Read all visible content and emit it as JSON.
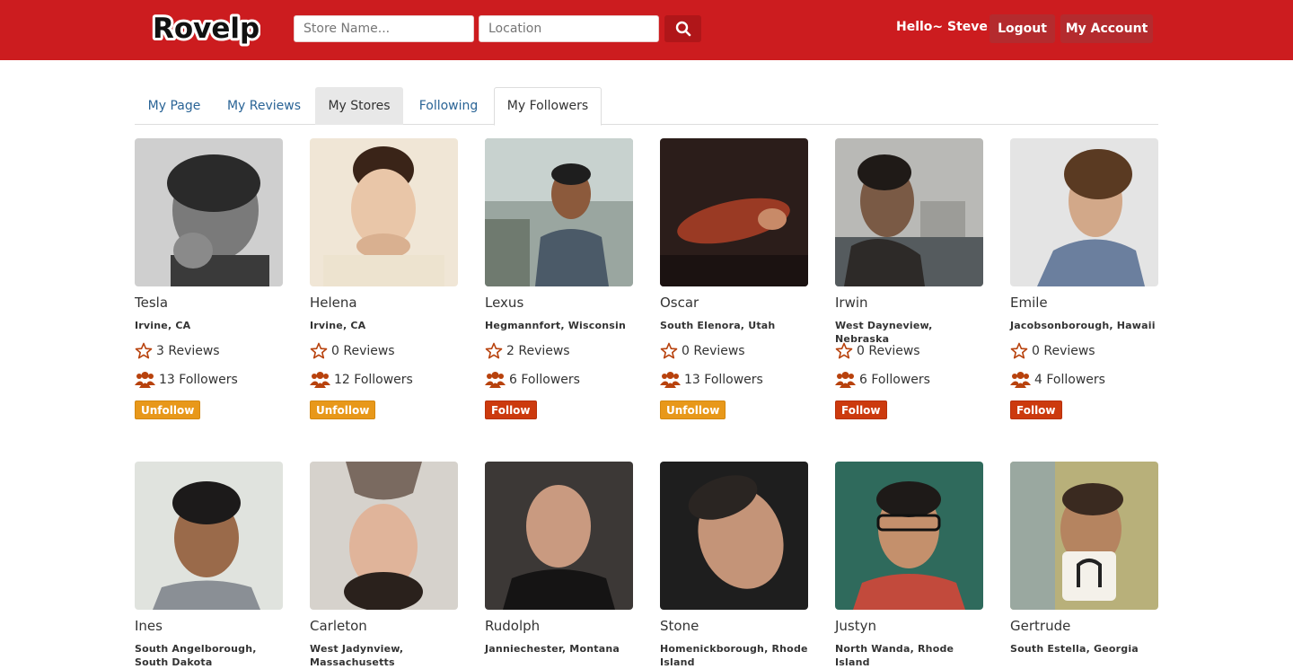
{
  "colors": {
    "brand": "#cc1c1f",
    "unfollow": "#e8981a",
    "follow": "#cc3a0e",
    "icon": "#b8420d"
  },
  "header": {
    "logo_text": "Rovelp",
    "store_placeholder": "Store Name...",
    "location_placeholder": "Location",
    "search_icon": "search-icon",
    "greeting": "Hello~ Steve",
    "logout_label": "Logout",
    "account_label": "My Account"
  },
  "tabs": [
    {
      "label": "My Page"
    },
    {
      "label": "My Reviews"
    },
    {
      "label": "My Stores"
    },
    {
      "label": "Following"
    },
    {
      "label": "My Followers",
      "active": true
    }
  ],
  "followers": [
    {
      "name": "Tesla",
      "location": "Irvine, CA",
      "reviews": "3 Reviews",
      "followers": "13 Followers",
      "button": "Unfollow"
    },
    {
      "name": "Helena",
      "location": "Irvine, CA",
      "reviews": "0 Reviews",
      "followers": "12 Followers",
      "button": "Unfollow"
    },
    {
      "name": "Lexus",
      "location": "Hegmannfort, Wisconsin",
      "reviews": "2 Reviews",
      "followers": "6 Followers",
      "button": "Follow"
    },
    {
      "name": "Oscar",
      "location": "South Elenora, Utah",
      "reviews": "0 Reviews",
      "followers": "13 Followers",
      "button": "Unfollow"
    },
    {
      "name": "Irwin",
      "location": "West Dayneview, Nebraska",
      "reviews": "0 Reviews",
      "followers": "6 Followers",
      "button": "Follow"
    },
    {
      "name": "Emile",
      "location": "Jacobsonborough, Hawaii",
      "reviews": "0 Reviews",
      "followers": "4 Followers",
      "button": "Follow"
    },
    {
      "name": "Ines",
      "location": "South Angelborough, South Dakota"
    },
    {
      "name": "Carleton",
      "location": "West Jadynview, Massachusetts"
    },
    {
      "name": "Rudolph",
      "location": "Janniechester, Montana"
    },
    {
      "name": "Stone",
      "location": "Homenickborough, Rhode Island"
    },
    {
      "name": "Justyn",
      "location": "North Wanda, Rhode Island"
    },
    {
      "name": "Gertrude",
      "location": "South Estella, Georgia"
    }
  ]
}
